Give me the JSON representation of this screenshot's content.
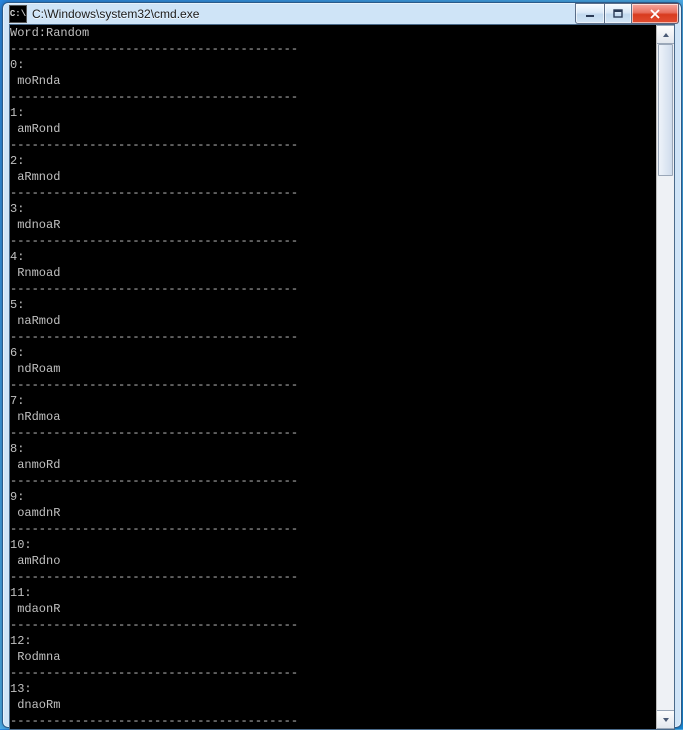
{
  "window": {
    "icon_text": "C:\\",
    "title": "C:\\Windows\\system32\\cmd.exe"
  },
  "console": {
    "header": "Word:Random",
    "separator": "----------------------------------------",
    "entries": [
      {
        "index": "0",
        "value": "moRnda"
      },
      {
        "index": "1",
        "value": "amRond"
      },
      {
        "index": "2",
        "value": "aRmnod"
      },
      {
        "index": "3",
        "value": "mdnoaR"
      },
      {
        "index": "4",
        "value": "Rnmoad"
      },
      {
        "index": "5",
        "value": "naRmod"
      },
      {
        "index": "6",
        "value": "ndRoam"
      },
      {
        "index": "7",
        "value": "nRdmoa"
      },
      {
        "index": "8",
        "value": "anmoRd"
      },
      {
        "index": "9",
        "value": "oamdnR"
      },
      {
        "index": "10",
        "value": "amRdno"
      },
      {
        "index": "11",
        "value": "mdaonR"
      },
      {
        "index": "12",
        "value": "Rodmna"
      },
      {
        "index": "13",
        "value": "dnaoRm"
      }
    ]
  }
}
